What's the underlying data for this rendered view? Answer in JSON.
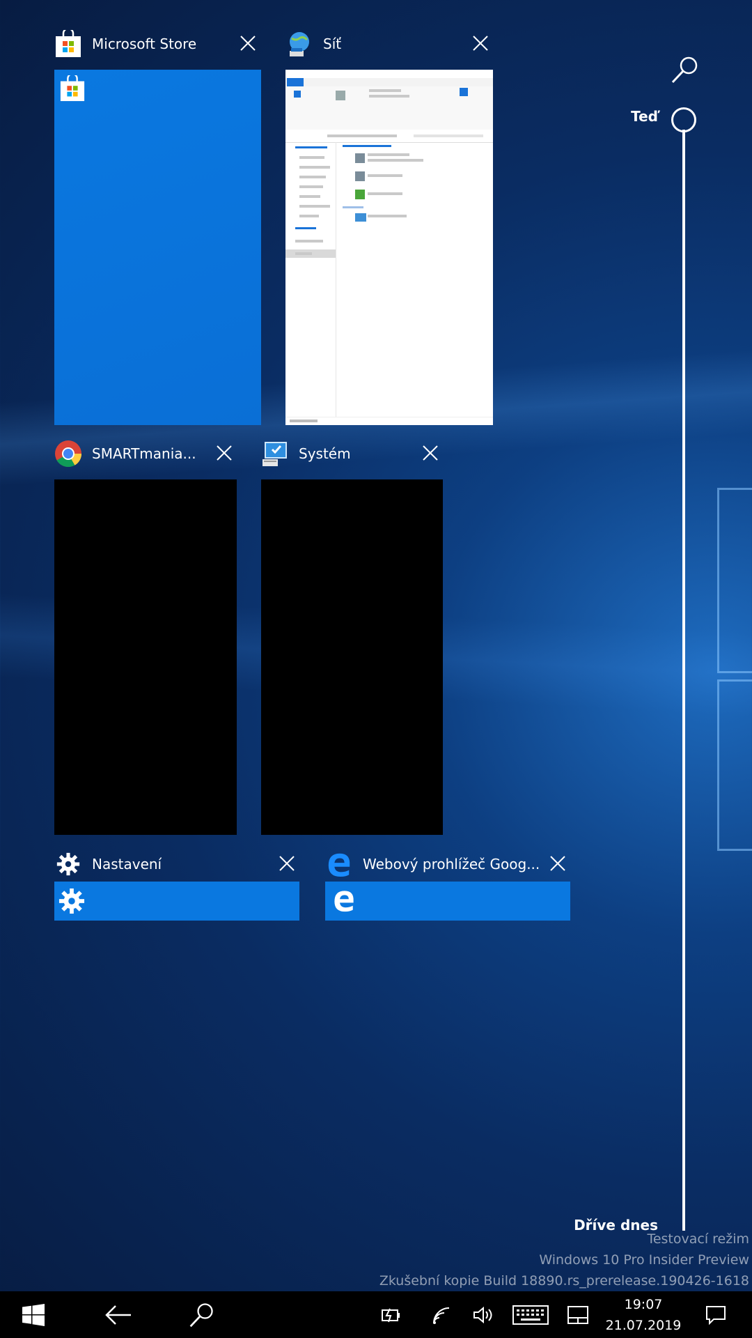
{
  "cards": [
    {
      "title": "Microsoft Store",
      "icon": "store-icon"
    },
    {
      "title": "Síť",
      "icon": "network-icon"
    },
    {
      "title": "SMARTmania....",
      "icon": "chrome-icon"
    },
    {
      "title": "Systém",
      "icon": "system-icon"
    },
    {
      "title": "Nastavení",
      "icon": "gear-icon"
    },
    {
      "title": "Webový prohlížeč Goog...",
      "icon": "edge-icon"
    }
  ],
  "timeline": {
    "now": "Teď",
    "earlier": "Dříve dnes"
  },
  "watermark": {
    "line1": "Testovací režim",
    "line2": "Windows 10 Pro Insider Preview",
    "line3": "Zkušební kopie Build 18890.rs_prerelease.190426-1618"
  },
  "taskbar": {
    "time": "19:07",
    "date": "21.07.2019"
  },
  "colors": {
    "accent": "#0078d7",
    "taskbar": "#000000"
  }
}
